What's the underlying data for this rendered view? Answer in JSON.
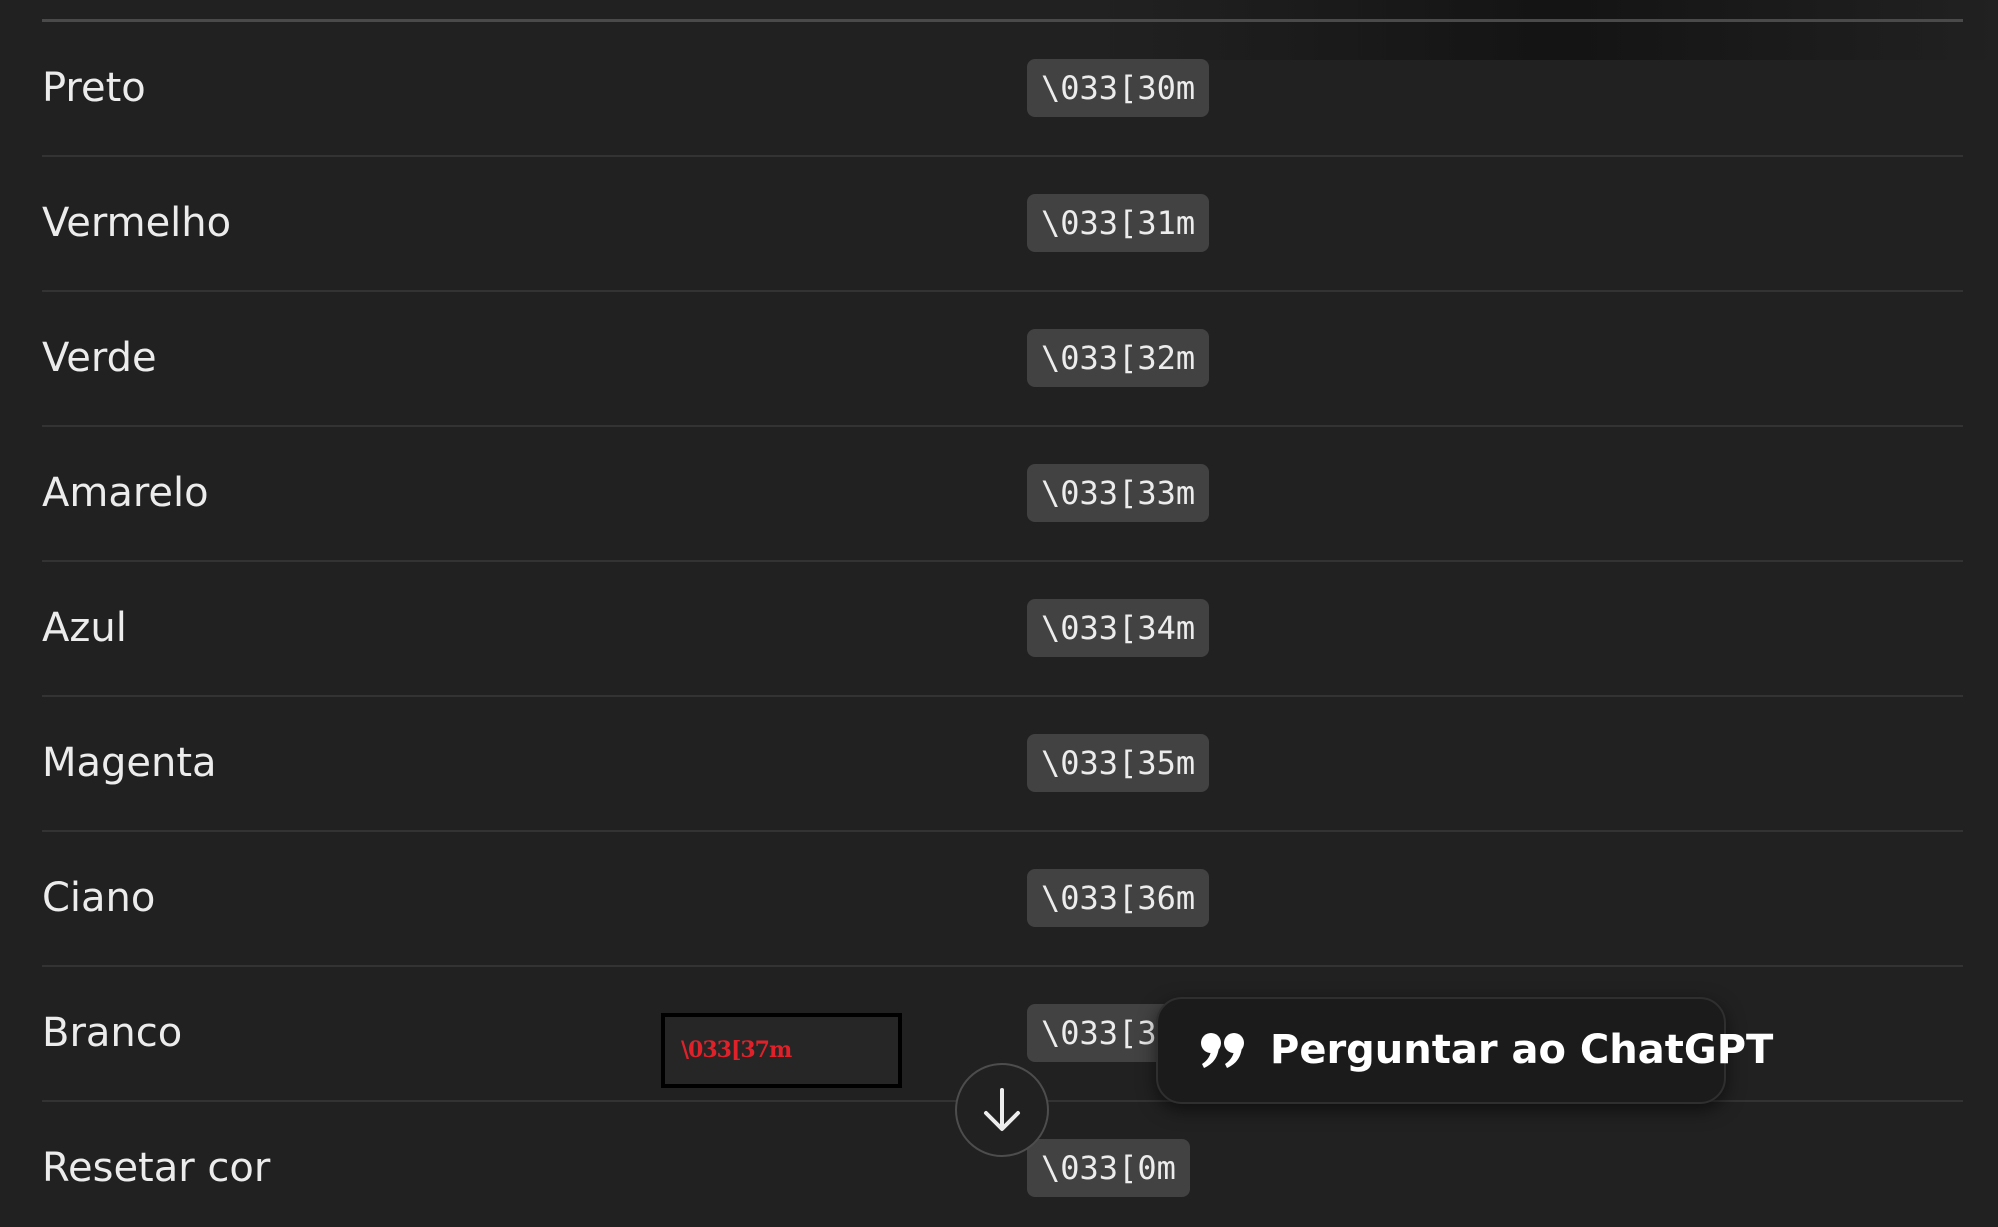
{
  "table": {
    "rows": [
      {
        "name": "Preto",
        "code": "\\033[30m"
      },
      {
        "name": "Vermelho",
        "code": "\\033[31m"
      },
      {
        "name": "Verde",
        "code": "\\033[32m"
      },
      {
        "name": "Amarelo",
        "code": "\\033[33m"
      },
      {
        "name": "Azul",
        "code": "\\033[34m"
      },
      {
        "name": "Magenta",
        "code": "\\033[35m"
      },
      {
        "name": "Ciano",
        "code": "\\033[36m"
      },
      {
        "name": "Branco",
        "code": "\\033[3"
      },
      {
        "name": "Resetar cor",
        "code": "\\033[0m"
      }
    ]
  },
  "overlay": {
    "preview_text": "\\033[37m",
    "ask_button_label": "Perguntar ao ChatGPT",
    "ask_button_icon": "quote-icon",
    "scroll_button_icon": "arrow-down-icon"
  },
  "colors": {
    "background": "#212121",
    "code_chip": "#424242",
    "preview_text": "#e0212a"
  }
}
